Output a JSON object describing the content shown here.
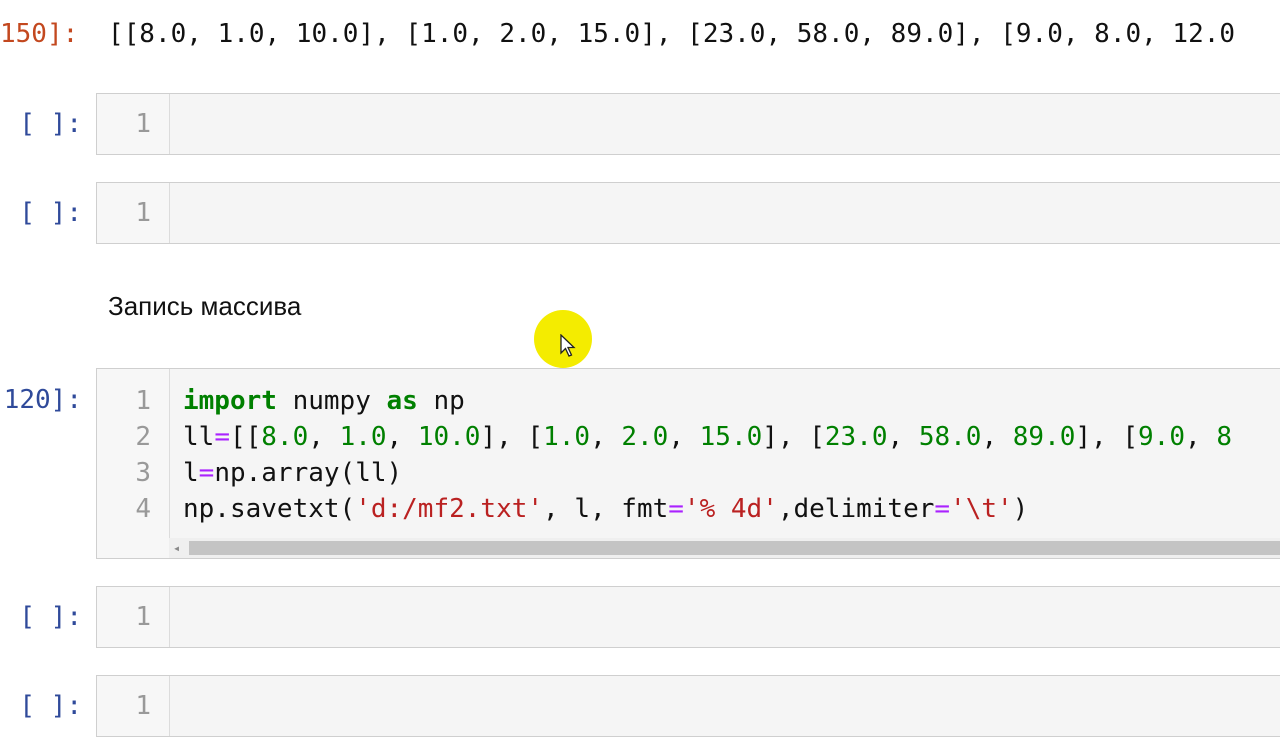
{
  "output_cell": {
    "prompt": "150]:",
    "text": "[[8.0, 1.0, 10.0], [1.0, 2.0, 15.0], [23.0, 58.0, 89.0], [9.0, 8.0, 12.0"
  },
  "empty_cells": [
    {
      "prompt": "[ ]:",
      "line": "1"
    },
    {
      "prompt": "[ ]:",
      "line": "1"
    },
    {
      "prompt": "[ ]:",
      "line": "1"
    },
    {
      "prompt": "[ ]:",
      "line": "1"
    }
  ],
  "markdown_cell": {
    "text": "Запись массива"
  },
  "code_cell": {
    "prompt": "120]:",
    "line_numbers": [
      "1",
      "2",
      "3",
      "4"
    ],
    "lines": {
      "l1": {
        "import": "import",
        "mod": " numpy ",
        "as": "as",
        "alias": " np"
      },
      "l2": {
        "var": "ll",
        "eq": "=",
        "p1": "[[",
        "n1": "8.0",
        "p2": ", ",
        "n2": "1.0",
        "p3": ", ",
        "n3": "10.0",
        "p4": "], [",
        "n4": "1.0",
        "p5": ", ",
        "n5": "2.0",
        "p6": ", ",
        "n6": "15.0",
        "p7": "], [",
        "n7": "23.0",
        "p8": ", ",
        "n8": "58.0",
        "p9": ", ",
        "n9": "89.0",
        "p10": "], [",
        "n10": "9.0",
        "p11": ", ",
        "n11": "8"
      },
      "l3": {
        "var": "l",
        "eq": "=",
        "rest": "np.array(ll)"
      },
      "l4": {
        "a": "np.savetxt(",
        "s1": "'d:/mf2.txt'",
        "b": ", l, fmt",
        "eq1": "=",
        "s2": "'% 4d'",
        "c": ",delimiter",
        "eq2": "=",
        "s3": "'\\t'",
        "d": ")"
      }
    }
  },
  "scroll": {
    "arrow": "◂"
  },
  "colors": {
    "prompt_out": "#c3481f",
    "prompt_in": "#2f4a9a",
    "keyword": "#008000",
    "string": "#ba2121",
    "cursor_highlight": "#f4ec00"
  }
}
